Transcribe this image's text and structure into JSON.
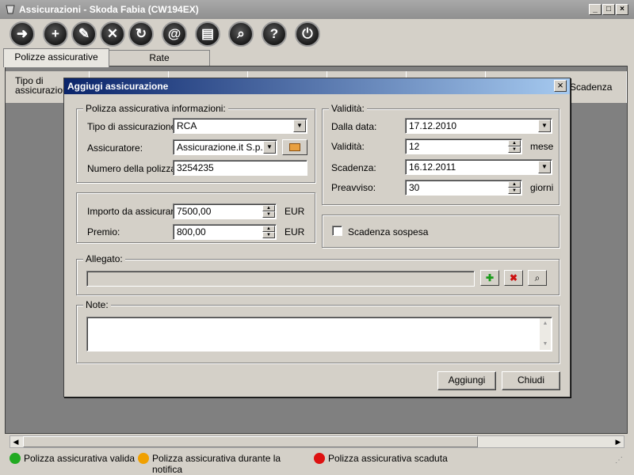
{
  "window": {
    "title": "Assicurazioni - Skoda Fabia (CW194EX)",
    "min": "_",
    "max": "□",
    "close": "×"
  },
  "toolbar": {
    "buttons": [
      {
        "name": "exit-icon",
        "glyph": "➜"
      },
      {
        "name": "add-icon",
        "glyph": "+"
      },
      {
        "name": "edit-icon",
        "glyph": "✎"
      },
      {
        "name": "delete-icon",
        "glyph": "✕"
      },
      {
        "name": "refresh-icon",
        "glyph": "↻"
      },
      {
        "name": "email-icon",
        "glyph": "@"
      },
      {
        "name": "print-icon",
        "glyph": "▤"
      },
      {
        "name": "search-icon",
        "glyph": "⌕"
      },
      {
        "name": "help-icon",
        "glyph": "?"
      },
      {
        "name": "power-icon",
        "glyph": "⏻"
      }
    ]
  },
  "tabs": [
    {
      "label": "Polizze assicurative"
    },
    {
      "label": "Rate"
    }
  ],
  "grid": {
    "col_first": "Tipo di assicurazione",
    "col_last": "Scadenza"
  },
  "dialog": {
    "title": "Aggiugi assicurazione",
    "close": "×",
    "policy_group": "Polizza assicurativa informazioni:",
    "type_label": "Tipo di assicurazione:",
    "type_value": "RCA",
    "insurer_label": "Assicuratore:",
    "insurer_value": "Assicurazione.it S.p.A.",
    "policy_no_label": "Numero della polizza:",
    "policy_no_value": "3254235",
    "amount_label": "Importo da assicurare:",
    "amount_value": "7500,00",
    "amount_unit": "EUR",
    "premium_label": "Premio:",
    "premium_value": "800,00",
    "premium_unit": "EUR",
    "validity_group": "Validità:",
    "from_label": "Dalla data:",
    "from_value": "17.12.2010",
    "validity_label": "Validità:",
    "validity_value": "12",
    "validity_unit": "mese",
    "expiry_label": "Scadenza:",
    "expiry_value": "16.12.2011",
    "notice_label": "Preavviso:",
    "notice_value": "30",
    "notice_unit": "giorni",
    "suspended_label": "Scadenza sospesa",
    "suspended_checked": false,
    "attachment_group": "Allegato:",
    "attachment_value": "",
    "notes_group": "Note:",
    "notes_value": "",
    "add_button": "Aggiungi",
    "close_button": "Chiudi"
  },
  "legend": [
    {
      "label": "Polizza assicurativa valida",
      "color": "#22aa22"
    },
    {
      "label": "Polizza assicurativa durante la notifica",
      "color": "#f0a000"
    },
    {
      "label": "Polizza assicurativa scaduta",
      "color": "#dd1111"
    }
  ]
}
